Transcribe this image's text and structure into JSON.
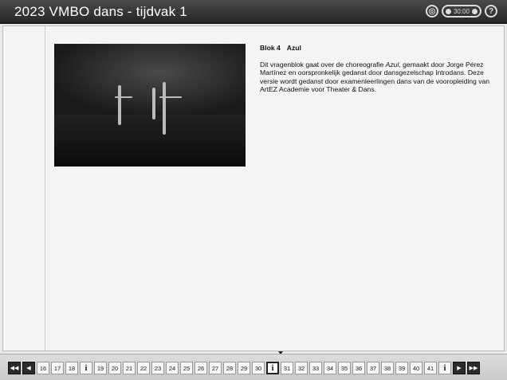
{
  "window": {
    "title": "2023 VMBO dans - tijdvak 1",
    "timer_text": "30:00",
    "icons": [
      "audio-icon",
      "timer-icon",
      "help-icon"
    ]
  },
  "content": {
    "block_number": "Blok 4",
    "block_title": "Azul",
    "paragraph": [
      {
        "t": "Dit vragenblok gaat over de choreografie ",
        "i": false
      },
      {
        "t": "Azul",
        "i": true
      },
      {
        "t": ", gemaakt door Jorge Pérez Martínez en oorspronkelijk gedanst door dansgezelschap Introdans. Deze versie wordt gedanst door examenleerlingen dans van de vooropleiding van ArtEZ Academie voor Theater & Dans.",
        "i": false
      }
    ],
    "video_alt": "dance performance still"
  },
  "navigation": {
    "buttons": [
      {
        "label": "◀◀",
        "type": "first"
      },
      {
        "label": "◀",
        "type": "prev"
      },
      {
        "label": "16"
      },
      {
        "label": "17"
      },
      {
        "label": "18"
      },
      {
        "label": "i",
        "type": "info"
      },
      {
        "label": "19"
      },
      {
        "label": "20"
      },
      {
        "label": "21"
      },
      {
        "label": "22"
      },
      {
        "label": "23"
      },
      {
        "label": "24"
      },
      {
        "label": "25"
      },
      {
        "label": "26"
      },
      {
        "label": "27"
      },
      {
        "label": "28"
      },
      {
        "label": "29"
      },
      {
        "label": "30"
      },
      {
        "label": "i",
        "type": "info",
        "active": true
      },
      {
        "label": "31"
      },
      {
        "label": "32"
      },
      {
        "label": "33"
      },
      {
        "label": "34"
      },
      {
        "label": "35"
      },
      {
        "label": "36"
      },
      {
        "label": "37"
      },
      {
        "label": "38"
      },
      {
        "label": "39"
      },
      {
        "label": "40"
      },
      {
        "label": "41"
      },
      {
        "label": "i",
        "type": "info"
      },
      {
        "label": "▶",
        "type": "next"
      },
      {
        "label": "▶▶",
        "type": "last"
      }
    ]
  }
}
